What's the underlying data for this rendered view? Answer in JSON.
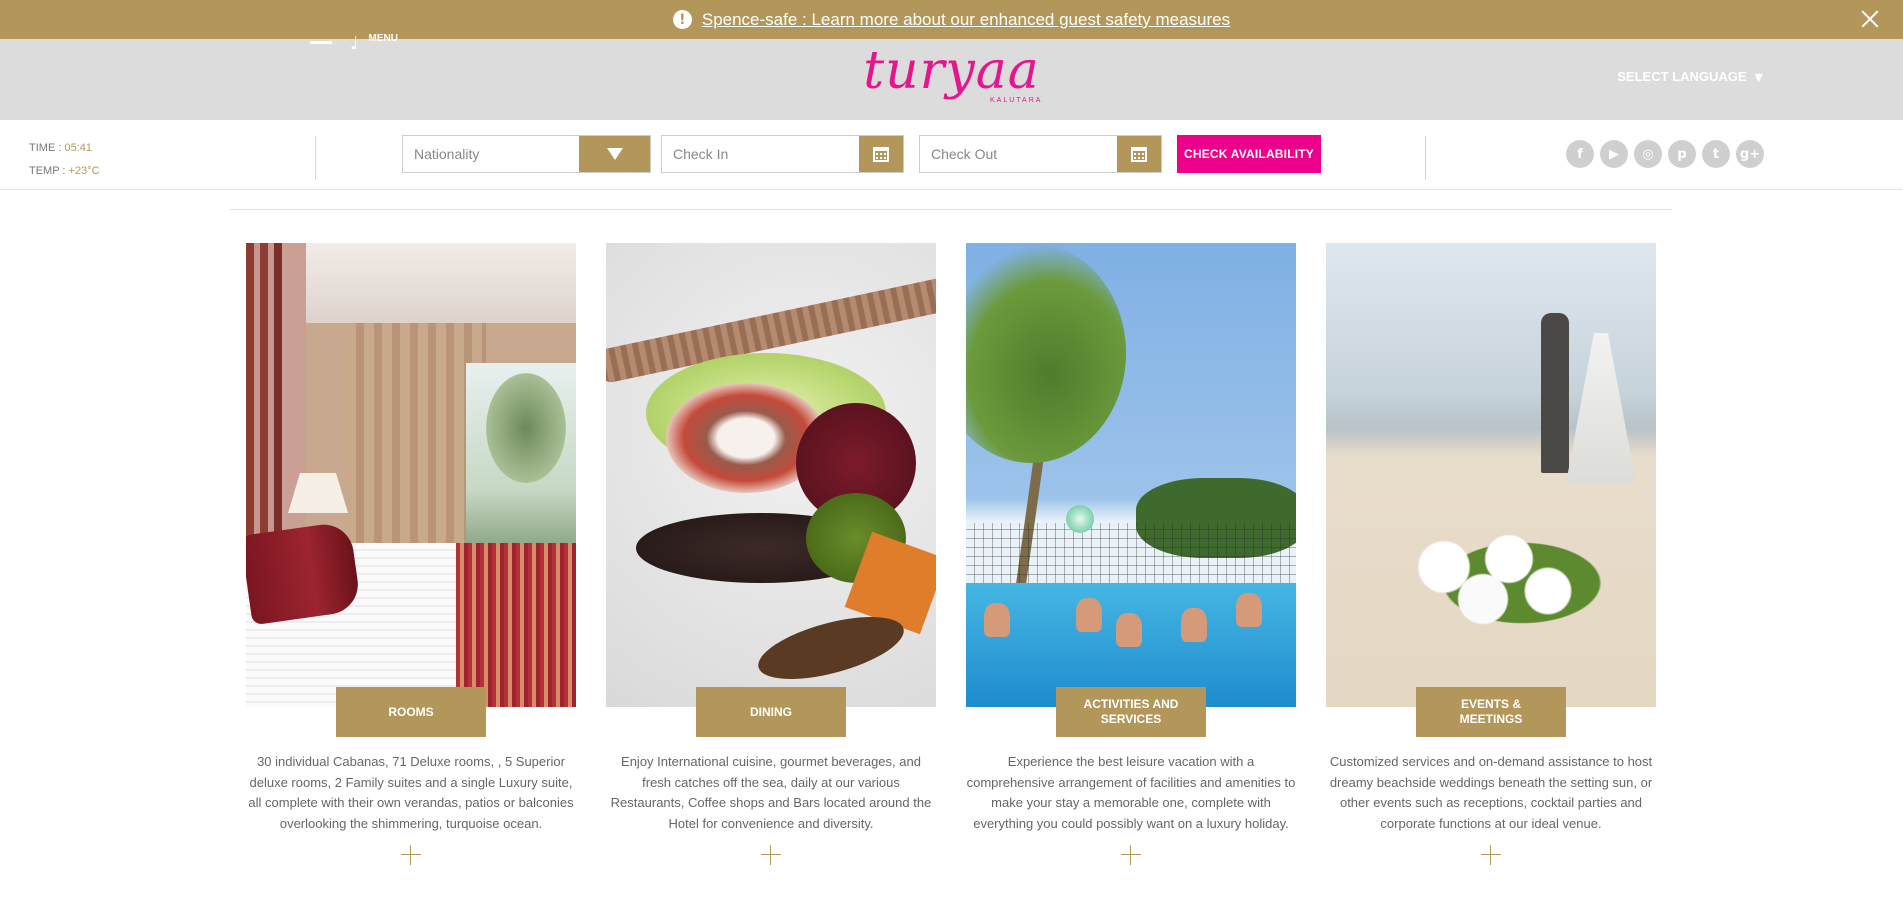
{
  "alert": {
    "icon": "exclamation-icon",
    "text": " Spence-safe : Learn more about our enhanced guest safety measures",
    "close_icon": "close-icon"
  },
  "header": {
    "menu_label": "MENU",
    "menu_glyph": "♩",
    "logo_text": "turyaa",
    "logo_subtext": "KALUTARA",
    "language_label": "SELECT LANGUAGE",
    "language_arrow": "▼"
  },
  "weather": {
    "time_label": "TIME :",
    "time_value": "05:41",
    "temp_label": "TEMP :",
    "temp_value": "+23°C"
  },
  "booking": {
    "nationality_placeholder": "Nationality",
    "checkin_placeholder": "Check In",
    "checkout_placeholder": "Check Out",
    "check_button": "CHECK AVAILABILITY"
  },
  "socials": [
    {
      "icon": "facebook-icon",
      "glyph": "f"
    },
    {
      "icon": "youtube-icon",
      "glyph": "▶"
    },
    {
      "icon": "instagram-icon",
      "glyph": "◎"
    },
    {
      "icon": "pinterest-icon",
      "glyph": "p"
    },
    {
      "icon": "twitter-icon",
      "glyph": "t"
    },
    {
      "icon": "google-plus-icon",
      "glyph": "g+"
    }
  ],
  "cards": [
    {
      "title": "ROOMS",
      "description": "30 individual Cabanas, 71 Deluxe rooms, , 5 Superior deluxe rooms, 2 Family suites and a single Luxury suite, all complete with their own verandas, patios or balconies overlooking the shimmering, turquoise ocean."
    },
    {
      "title": "DINING",
      "description": "Enjoy International cuisine, gourmet beverages, and fresh catches off the sea, daily at our various Restaurants, Coffee shops and Bars located around the Hotel for convenience and diversity."
    },
    {
      "title": "ACTIVITIES AND\nSERVICES",
      "description": "Experience the best leisure vacation with a comprehensive arrangement of facilities and amenities to make your stay a memorable one, complete with everything you could possibly want on a luxury holiday."
    },
    {
      "title": "EVENTS &\nMEETINGS",
      "description": "Customized services and on-demand assistance to host dreamy beachside weddings beneath the setting sun, or other events such as receptions, cocktail parties and corporate functions at our ideal venue."
    }
  ],
  "colors": {
    "gold": "#b3975a",
    "pink": "#ec008c",
    "header_bg": "#dcdcdc"
  }
}
